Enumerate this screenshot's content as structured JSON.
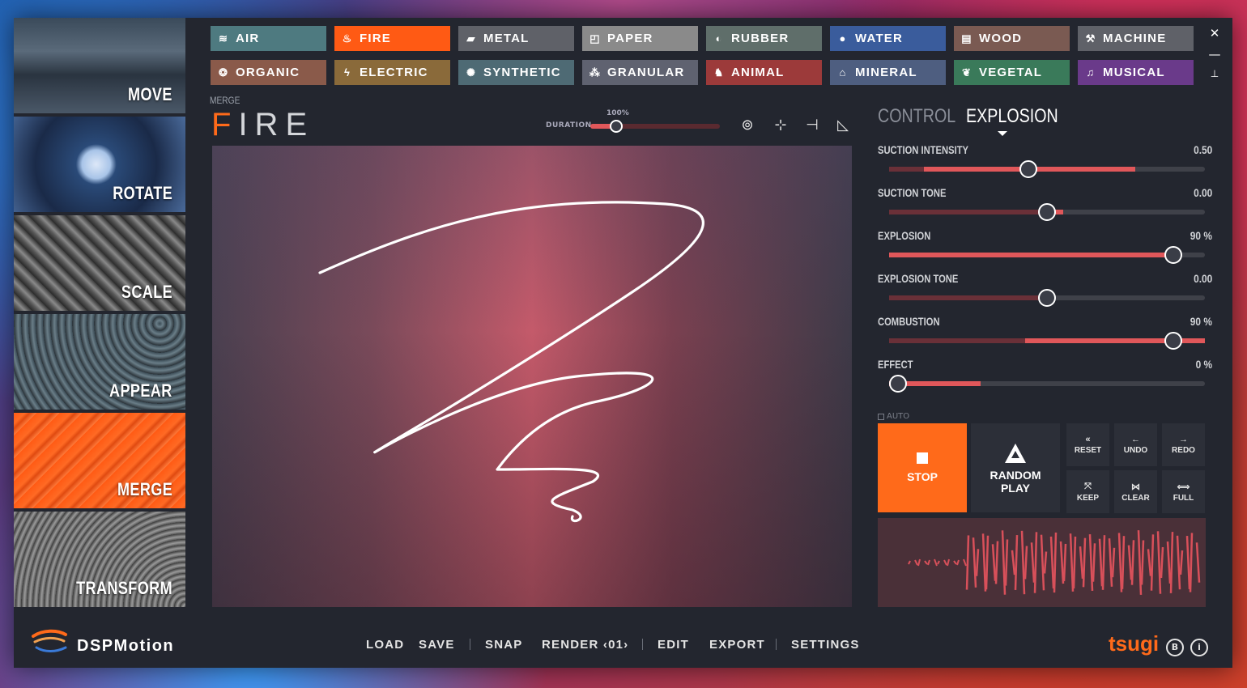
{
  "app": {
    "brand": "DSPMotion",
    "publisher": "tsugi"
  },
  "sidebar": {
    "items": [
      {
        "label": "MOVE"
      },
      {
        "label": "ROTATE"
      },
      {
        "label": "SCALE"
      },
      {
        "label": "APPEAR"
      },
      {
        "label": "MERGE",
        "active": true
      },
      {
        "label": "TRANSFORM"
      }
    ]
  },
  "categories": {
    "row1": [
      {
        "label": "AIR",
        "icon": "wind-icon",
        "color": "#4e7a80"
      },
      {
        "label": "FIRE",
        "icon": "flame-icon",
        "color": "#ff5a14"
      },
      {
        "label": "METAL",
        "icon": "metal-icon",
        "color": "#5f6168"
      },
      {
        "label": "PAPER",
        "icon": "paper-icon",
        "color": "#8a8a8a"
      },
      {
        "label": "RUBBER",
        "icon": "rubber-icon",
        "color": "#5f6e6a"
      },
      {
        "label": "WATER",
        "icon": "drop-icon",
        "color": "#3a5c9c"
      },
      {
        "label": "WOOD",
        "icon": "wood-icon",
        "color": "#7a5a52"
      },
      {
        "label": "MACHINE",
        "icon": "wrench-icon",
        "color": "#5f6168"
      }
    ],
    "row2": [
      {
        "label": "ORGANIC",
        "icon": "organic-icon",
        "color": "#8a5a4a"
      },
      {
        "label": "ELECTRIC",
        "icon": "bolt-icon",
        "color": "#8a6a3a"
      },
      {
        "label": "SYNTHETIC",
        "icon": "synthetic-icon",
        "color": "#4e6a74"
      },
      {
        "label": "GRANULAR",
        "icon": "granular-icon",
        "color": "#5f6270"
      },
      {
        "label": "ANIMAL",
        "icon": "animal-icon",
        "color": "#9c3a3a"
      },
      {
        "label": "MINERAL",
        "icon": "mineral-icon",
        "color": "#4e5e80"
      },
      {
        "label": "VEGETAL",
        "icon": "leaf-icon",
        "color": "#3a7a5a"
      },
      {
        "label": "MUSICAL",
        "icon": "note-icon",
        "color": "#6a3a8a"
      }
    ]
  },
  "window": {
    "close": "✕",
    "minimize": "—",
    "pin": "📌"
  },
  "header": {
    "mode": "MERGE",
    "title_first": "F",
    "title_rest": "IRE",
    "duration_label": "DURATION",
    "duration_value": "100%",
    "duration_fraction": 0.2
  },
  "tabs": {
    "control": "CONTROL",
    "explosion": "EXPLOSION"
  },
  "params": [
    {
      "name": "SUCTION INTENSITY",
      "value": "0.50",
      "pos": 0.44,
      "fill_from": 0.11,
      "fill_to": 0.78,
      "dim_from": 0.0,
      "dim_to": 0.11
    },
    {
      "name": "SUCTION TONE",
      "value": "0.00",
      "pos": 0.5,
      "fill_from": 0.5,
      "fill_to": 0.55,
      "dim_from": 0.0,
      "dim_to": 0.5
    },
    {
      "name": "EXPLOSION",
      "value": "90 %",
      "pos": 0.9,
      "fill_from": 0.0,
      "fill_to": 0.9,
      "dim_from": 0.0,
      "dim_to": 0.0
    },
    {
      "name": "EXPLOSION TONE",
      "value": "0.00",
      "pos": 0.5,
      "fill_from": 0.5,
      "fill_to": 0.5,
      "dim_from": 0.0,
      "dim_to": 0.5
    },
    {
      "name": "COMBUSTION",
      "value": "90 %",
      "pos": 0.9,
      "fill_from": 0.43,
      "fill_to": 1.0,
      "dim_from": 0.0,
      "dim_to": 0.43
    },
    {
      "name": "EFFECT",
      "value": "0 %",
      "pos": 0.0,
      "fill_from": 0.0,
      "fill_to": 0.29,
      "dim_from": 0.0,
      "dim_to": 0.0
    }
  ],
  "controls": {
    "auto": "AUTO",
    "stop": "STOP",
    "random_1": "RANDOM",
    "random_2": "PLAY",
    "reset": "RESET",
    "undo": "UNDO",
    "redo": "REDO",
    "keep": "KEEP",
    "clear": "CLEAR",
    "full": "FULL"
  },
  "menu": {
    "load": "LOAD",
    "save": "SAVE",
    "snap": "SNAP",
    "render": "RENDER ‹01›",
    "edit": "EDIT",
    "export": "EXPORT",
    "settings": "SETTINGS"
  },
  "colors": {
    "accent": "#ff6a1a",
    "slider": "#e0575a",
    "panel": "#23262f"
  }
}
